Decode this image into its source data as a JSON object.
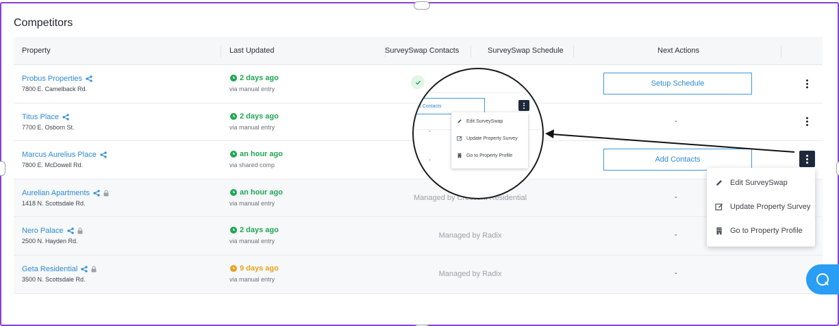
{
  "section_title": "Competitors",
  "columns": {
    "property": "Property",
    "last_updated": "Last Updated",
    "contacts": "SurveySwap Contacts",
    "schedule": "SurveySwap Schedule",
    "next_actions": "Next Actions"
  },
  "rows": [
    {
      "name": "Probus Properties",
      "address": "7800 E. Camelback Rd.",
      "updated": "2 days ago",
      "via": "via manual entry",
      "status_color": "#1fa652",
      "next_action": "Setup Schedule",
      "locked": false
    },
    {
      "name": "Titus Place",
      "address": "7700 E. Osborn St.",
      "updated": "2 days ago",
      "via": "via manual entry",
      "status_color": "#1fa652",
      "next_action": "-",
      "locked": false
    },
    {
      "name": "Marcus Aurelius Place",
      "address": "7800 E. McDowell Rd.",
      "updated": "an hour ago",
      "via": "via shared comp",
      "status_color": "#1fa652",
      "next_action": "Add Contacts",
      "locked": false
    },
    {
      "name": "Aurelian Apartments",
      "address": "1418 N. Scottsdale Rd.",
      "updated": "an hour ago",
      "via": "via manual entry",
      "status_color": "#1fa652",
      "managed": "Managed by Crescent Residential",
      "next_action": "-",
      "locked": true
    },
    {
      "name": "Nero Palace",
      "address": "2500 N. Hayden Rd.",
      "updated": "2 days ago",
      "via": "via manual entry",
      "status_color": "#1fa652",
      "managed": "Managed by Radix",
      "next_action": "-",
      "locked": true
    },
    {
      "name": "Geta Residential",
      "address": "3500 N. Scottsdale Rd.",
      "updated": "9 days ago",
      "via": "via manual entry",
      "status_color": "#e8a21c",
      "managed": "Managed by Radix",
      "next_action": "-",
      "locked": true
    }
  ],
  "dropdown": {
    "items": [
      {
        "label": "Edit SurveySwap",
        "icon": "pencil-icon"
      },
      {
        "label": "Update Property Survey",
        "icon": "edit-survey-icon"
      },
      {
        "label": "Go to Property Profile",
        "icon": "building-icon"
      }
    ]
  },
  "magnifier": {
    "button_label": "d Contacts",
    "dash": "-"
  },
  "colors": {
    "accent": "#2a8ad6",
    "frame": "#8a3fd1",
    "help": "#2a9df4",
    "kebab_active": "#1e2a3b"
  }
}
